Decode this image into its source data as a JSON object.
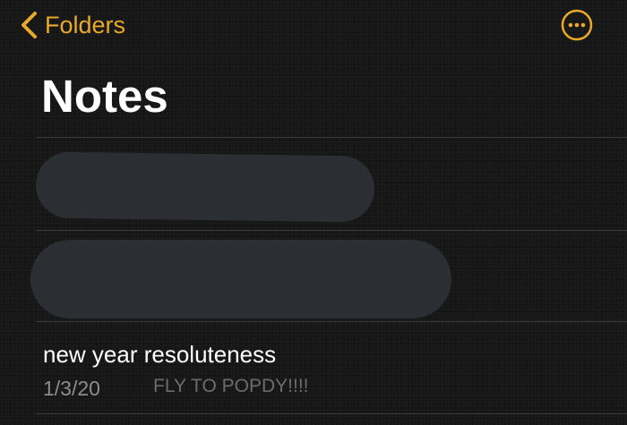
{
  "colors": {
    "accent": "#e8a92b",
    "background": "#171717",
    "divider": "#3b3b3b",
    "redaction": "#2b2f33",
    "secondary_text": "#8d8d8d",
    "preview_text": "#6c6c6c"
  },
  "nav": {
    "back_label": "Folders",
    "back_icon": "chevron-left-icon",
    "more_icon": "ellipsis-circle-icon"
  },
  "header": {
    "title": "Notes"
  },
  "notes": [
    {
      "title": "new year resoluteness",
      "date": "1/3/20",
      "preview": "FLY TO POPDY!!!!"
    }
  ]
}
